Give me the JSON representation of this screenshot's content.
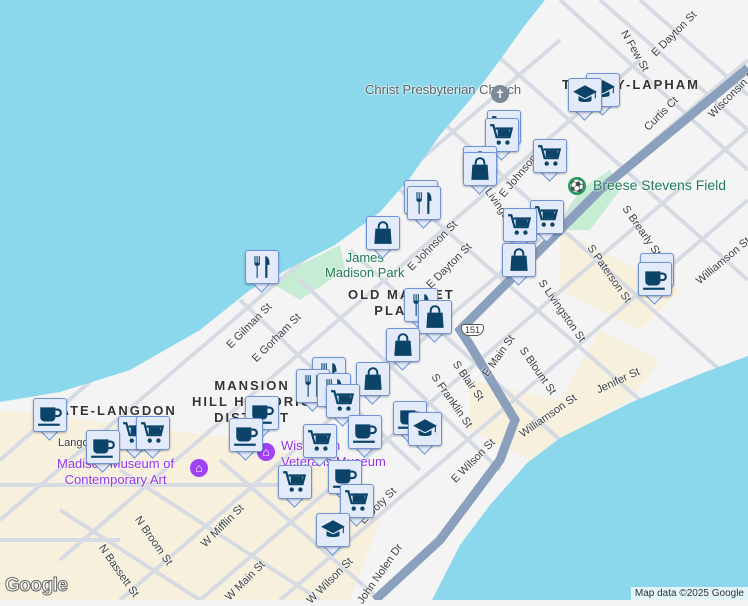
{
  "map": {
    "colors": {
      "water": "#8bd8ed",
      "land": "#f5f4f5",
      "park": "#c6ecd4",
      "road": "#d6dbe3",
      "highway": "#8aa0bd",
      "commercial": "#f7f0dc",
      "marker_fill": "#e3ebfb",
      "marker_icon": "#0b4468"
    },
    "places": {
      "church": "Christ Presbyterian Church",
      "park1": "James",
      "park2": "Madison Park",
      "field": "Breese Stevens Field",
      "museum1": "Madison Museum of",
      "museum2": "Contemporary Art",
      "veterans1": "Wisconsin",
      "veterans2": "Veterans Museum",
      "district_tenney": "TENNEY-LAPHAM",
      "district_old_market1": "OLD MARKET",
      "district_old_market2": "PLACE",
      "district_mansion1": "MANSION",
      "district_mansion2": "HILL HISTORIC",
      "district_mansion3": "DISTRICT",
      "district_langdon": "STATE-LANGDON",
      "langdon_st": "Langdon St"
    },
    "streets": [
      "N Few St",
      "E Dayton St",
      "Curtis Ct",
      "E Johnson St",
      "E Dayton St",
      "N Livingston St",
      "S Brearly St",
      "S Paterson St",
      "S Livingston St",
      "Williamson St",
      "E Gilman St",
      "E Gorham St",
      "N Broom St",
      "W Mifflin St",
      "N Bassett St",
      "W Main St",
      "W Wilson St",
      "E Main St",
      "S Blount St",
      "S Blair St",
      "S Franklin St",
      "Jenifer St",
      "Williamson St",
      "E Wilson St",
      "E Doty St",
      "John Nolen Dr",
      "Wisconsin Ave",
      "E Johnson St"
    ],
    "route_shield": "151",
    "attribution": "Map data ©2025 Google",
    "logo": "Google",
    "markers": [
      "graduation",
      "graduation",
      "cart",
      "cart",
      "bag",
      "bag",
      "cart",
      "restaurant",
      "restaurant",
      "bag",
      "cart",
      "cart",
      "bag",
      "restaurant",
      "coffee",
      "coffee",
      "restaurant",
      "bag",
      "bag",
      "restaurant",
      "restaurant",
      "restaurant",
      "bag",
      "cart",
      "coffee",
      "cart",
      "cart",
      "coffee",
      "coffee",
      "coffee",
      "cart",
      "coffee",
      "coffee",
      "graduation",
      "cart",
      "coffee",
      "cart",
      "graduation"
    ]
  }
}
